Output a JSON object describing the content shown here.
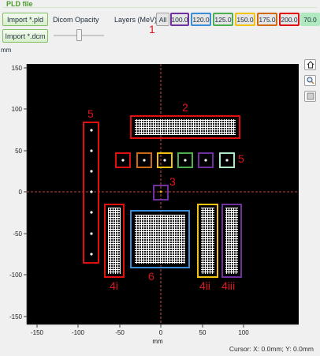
{
  "group": {
    "title": "PLD file"
  },
  "buttons": {
    "import_pld": "Import *.pld",
    "import_dcm": "Import *.dcm"
  },
  "opacity": {
    "label": "Dicom Opacity",
    "value": 0.5
  },
  "layers": {
    "label": "Layers (MeV):",
    "items": [
      {
        "label": "All",
        "color": "#a0a0a0"
      },
      {
        "label": "100.0",
        "color": "#7030a0"
      },
      {
        "label": "120.0",
        "color": "#3a8ed8"
      },
      {
        "label": "125.0",
        "color": "#4caf50"
      },
      {
        "label": "150.0",
        "color": "#f1c40f"
      },
      {
        "label": "175.0",
        "color": "#d06a10"
      },
      {
        "label": "200.0",
        "color": "#e01010"
      },
      {
        "label": "70.0",
        "color": "#b0e8c0"
      }
    ]
  },
  "plot": {
    "y_unit": "mm",
    "x_unit": "mm",
    "x_ticks": [
      "-150",
      "-100",
      "-50",
      "0",
      "50",
      "100"
    ],
    "y_ticks": [
      "150",
      "100",
      "50",
      "0",
      "-50",
      "-100",
      "-150"
    ]
  },
  "annotations": {
    "a1": "1",
    "a2": "2",
    "a3": "3",
    "a5_left": "5",
    "a5_right": "5",
    "a4i": "4i",
    "a4ii": "4ii",
    "a4iii": "4iii",
    "a6": "6"
  },
  "side_tools": [
    "home-icon",
    "zoom-icon",
    "pan-icon"
  ],
  "status": {
    "cursor": "Cursor: X: 0.0mm; Y: 0.0mm"
  }
}
